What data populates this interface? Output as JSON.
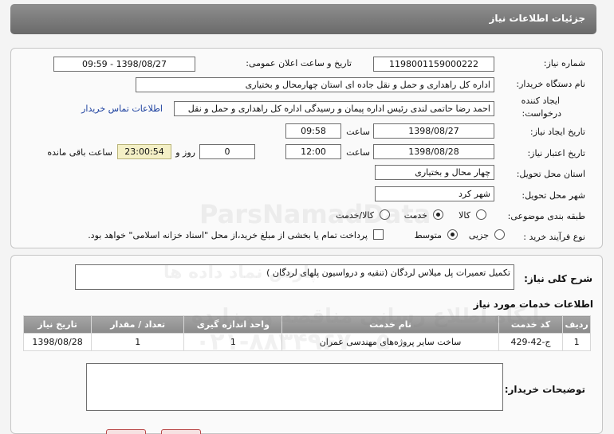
{
  "header": {
    "title": "جزئیات اطلاعات نیاز"
  },
  "form": {
    "need_number": {
      "label": "شماره نیاز:",
      "value": "1198001159000222"
    },
    "announce": {
      "label": "تاریخ و ساعت اعلان عمومی:",
      "value": "1398/08/27 - 09:59"
    },
    "buyer_org": {
      "label": "نام دستگاه خریدار:",
      "value": "اداره کل راهداری و حمل و نقل جاده ای استان چهارمحال و بختیاری"
    },
    "creator": {
      "label1": "ایجاد کننده",
      "label2": "درخواست:",
      "value": "احمد رضا  حاتمی لندی رئیس اداره پیمان و رسیدگی اداره کل راهداری و حمل و نقل",
      "contact_link": "اطلاعات تماس خریدار"
    },
    "create_date": {
      "label": "تاریخ ایجاد نیاز:",
      "date": "1398/08/27",
      "time_label": "ساعت",
      "time": "09:58"
    },
    "validity": {
      "label": "تاریخ اعتبار نیاز:",
      "date": "1398/08/28",
      "time_label": "ساعت",
      "time": "12:00",
      "days": "0",
      "days_label": "روز و",
      "remaining": "23:00:54",
      "remaining_label": "ساعت باقی مانده"
    },
    "province": {
      "label": "استان محل تحویل:",
      "value": "چهار محال و بختیاری"
    },
    "city": {
      "label": "شهر محل تحویل:",
      "value": "شهر کرد"
    },
    "category": {
      "label": "طبقه بندی موضوعی:",
      "options": [
        "کالا",
        "خدمت",
        "کالا/خدمت"
      ],
      "selected": "خدمت"
    },
    "purchase_type": {
      "label": "نوع فرآیند خرید :",
      "options": [
        "جزیی",
        "متوسط"
      ],
      "selected": "متوسط",
      "payment_note": "پرداخت تمام یا بخشی از مبلغ خرید،از محل \"اسناد خزانه اسلامی\" خواهد بود."
    }
  },
  "description": {
    "label": "شرح کلی نیاز:",
    "value": "تکمیل تعمیرات پل میلاس  لردگان (تنقیه و درواسیون پلهای لردگان )"
  },
  "services": {
    "title": "اطلاعات خدمات مورد نیاز",
    "columns": [
      "ردیف",
      "کد خدمت",
      "نام خدمت",
      "واحد اندازه گیری",
      "تعداد / مقدار",
      "تاریخ نیاز"
    ],
    "rows": [
      [
        "1",
        "ج-42-429",
        "ساخت سایر پروژه‌های مهندسی عمران",
        "1",
        "1",
        "1398/08/28"
      ]
    ]
  },
  "buyer_notes": {
    "label": "توضیحات خریدار:",
    "value": ""
  },
  "watermark": {
    "line1": "پایگاه اطلاع رسانی مناقصه و مزایده",
    "line2": "۰۲۱-۸۸۳۴۹۶۷۰-۵",
    "line3": "ParsNamadData",
    "line4": "پارس نماد داده ها"
  }
}
